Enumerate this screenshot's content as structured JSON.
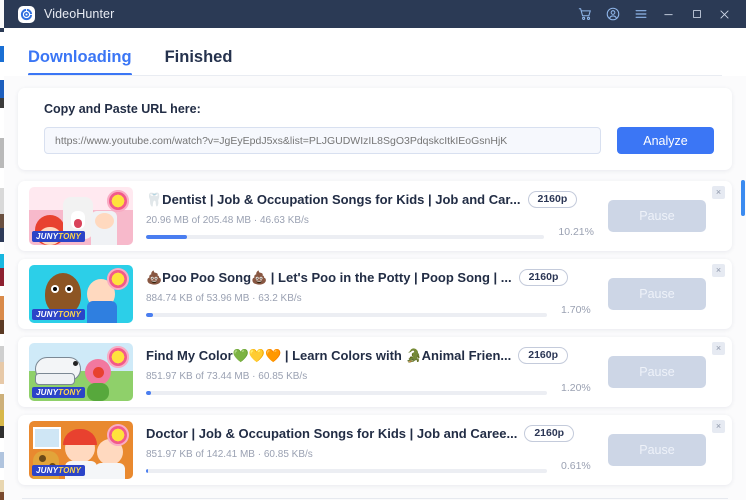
{
  "titlebar": {
    "app_name": "VideoHunter",
    "logo_icon": "videohunter-logo-icon",
    "icons": [
      {
        "name": "cart-icon",
        "glyph": "cart"
      },
      {
        "name": "account-icon",
        "glyph": "account"
      },
      {
        "name": "menu-icon",
        "glyph": "hamburger"
      },
      {
        "name": "minimize-icon",
        "glyph": "minimize"
      },
      {
        "name": "maximize-icon",
        "glyph": "maximize"
      },
      {
        "name": "close-icon",
        "glyph": "close"
      }
    ],
    "colors": {
      "bar_bg": "#2b3a55",
      "icon_blue": "#8fb6ea",
      "title_text": "#e8ecf4"
    }
  },
  "tabs": [
    {
      "label": "Downloading",
      "active": true
    },
    {
      "label": "Finished",
      "active": false
    }
  ],
  "url_card": {
    "label": "Copy and Paste URL here:",
    "input_value": "",
    "input_placeholder": "https://www.youtube.com/watch?v=JgEyEpdJ5xs&list=PLJGUDWIzIL8SgO3PdqskcItkIEoGsnHjK",
    "analyze_label": "Analyze",
    "accent_color": "#3b76f5"
  },
  "downloads": [
    {
      "title": "🦷Dentist | Job & Occupation Songs for Kids | Job and Car...",
      "resolution": "2160p",
      "meta": "20.96 MB of 205.48 MB · 46.63 KB/s",
      "percent_label": "10.21%",
      "percent_value": 10.21,
      "action_label": "Pause",
      "thumb_bg": "#f6c0cf",
      "thumb_accent": "#f06292",
      "channel_badge_a": "JUNY",
      "channel_badge_b": "TONY"
    },
    {
      "title": "💩Poo Poo Song💩 | Let's Poo in the Potty | Poop Song | ...",
      "resolution": "2160p",
      "meta": "884.74 KB of 53.96 MB · 63.2 KB/s",
      "percent_label": "1.70%",
      "percent_value": 1.7,
      "action_label": "Pause",
      "thumb_bg": "#25cde6",
      "thumb_accent": "#8d5524",
      "channel_badge_a": "JUNY",
      "channel_badge_b": "TONY"
    },
    {
      "title": "Find My Color💚💛🧡 | Learn Colors with 🐊Animal Frien...",
      "resolution": "2160p",
      "meta": "851.97 KB of 73.44 MB · 60.85 KB/s",
      "percent_label": "1.20%",
      "percent_value": 1.2,
      "action_label": "Pause",
      "thumb_bg": "#bfe9f7",
      "thumb_accent": "#78c850",
      "channel_badge_a": "JUNY",
      "channel_badge_b": "TONY"
    },
    {
      "title": "Doctor | Job & Occupation Songs for Kids | Job and Caree...",
      "resolution": "2160p",
      "meta": "851.97 KB of 142.41 MB · 60.85 KB/s",
      "percent_label": "0.61%",
      "percent_value": 0.61,
      "action_label": "Pause",
      "thumb_bg": "#e8a33d",
      "thumb_accent": "#d98a4a",
      "channel_badge_a": "JUNY",
      "channel_badge_b": "TONY"
    }
  ],
  "close_glyph": "×",
  "scrollbar": {
    "color": "#3b8bf0"
  }
}
